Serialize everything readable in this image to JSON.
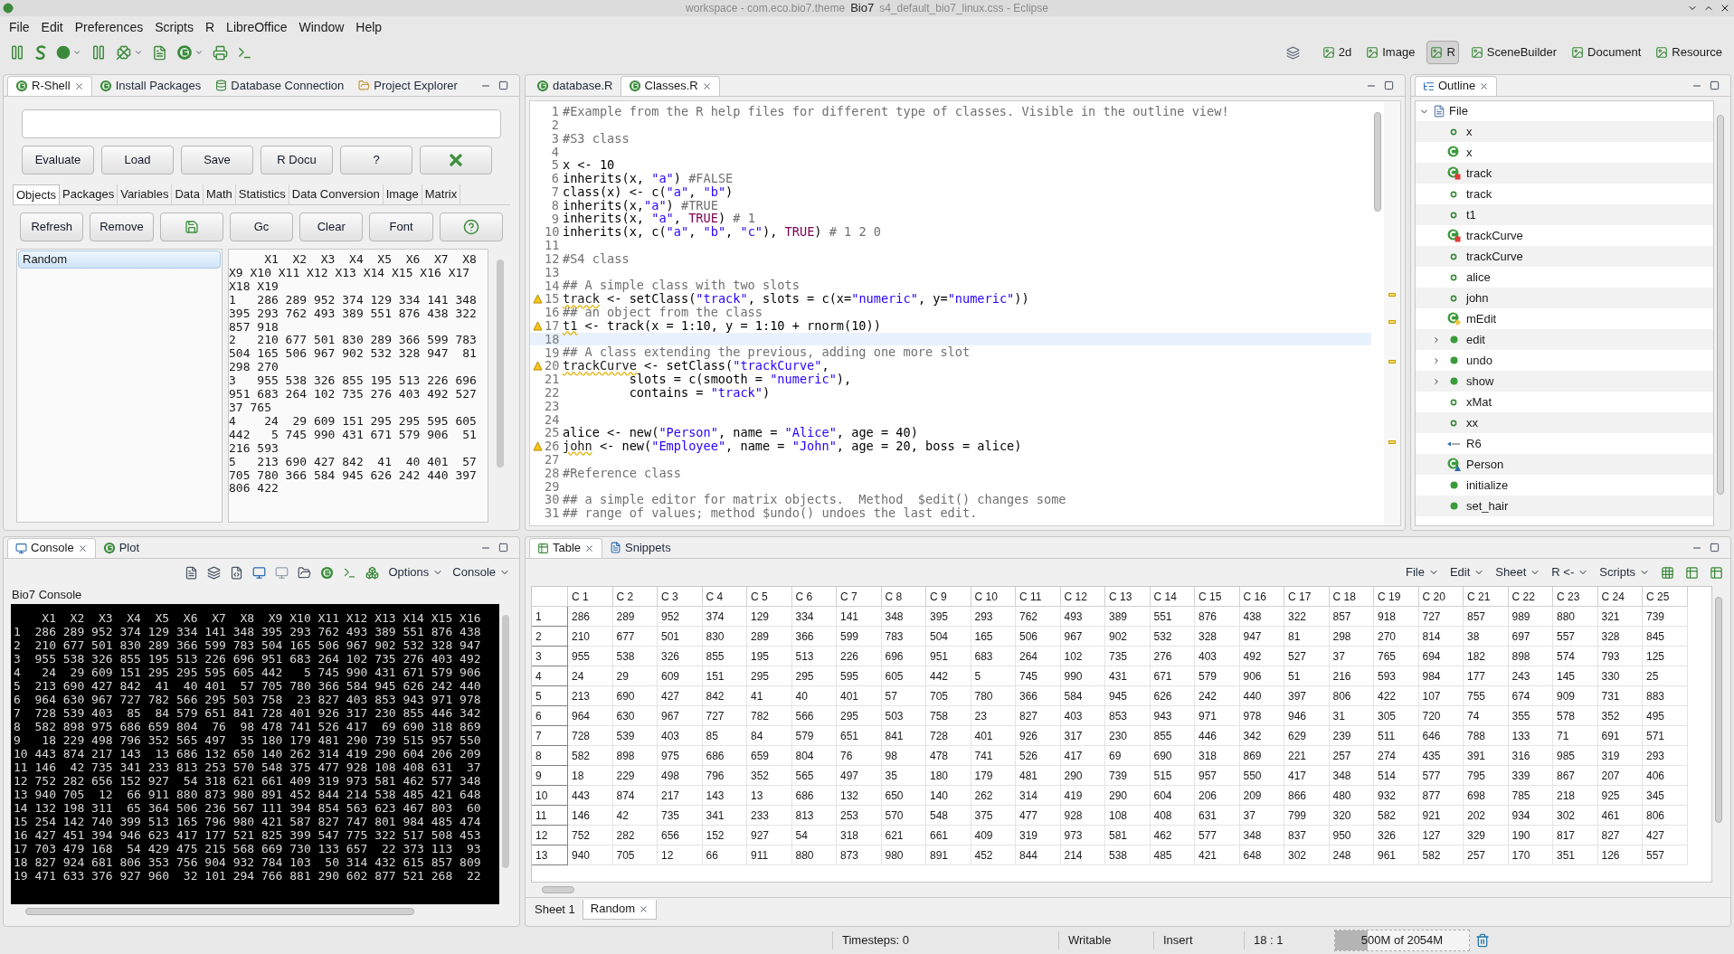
{
  "window": {
    "title": "Bio7",
    "caption": "workspace - com.eco.bio7.theme",
    "caption_end": "s4_default_bio7_linux.css - Eclipse"
  },
  "menu": [
    "File",
    "Edit",
    "Preferences",
    "Scripts",
    "R",
    "LibreOffice",
    "Window",
    "Help"
  ],
  "perspectives": [
    {
      "label": "2d",
      "selected": false
    },
    {
      "label": "Image",
      "selected": false
    },
    {
      "label": "R",
      "selected": true
    },
    {
      "label": "SceneBuilder",
      "selected": false
    },
    {
      "label": "Document",
      "selected": false
    },
    {
      "label": "Resource",
      "selected": false
    }
  ],
  "rshell": {
    "tabs": [
      {
        "label": "R-Shell",
        "selected": true,
        "closable": true
      },
      {
        "label": "Install Packages",
        "selected": false,
        "closable": false
      },
      {
        "label": "Database Connection",
        "selected": false,
        "closable": false
      },
      {
        "label": "Project Explorer",
        "selected": false,
        "closable": false
      }
    ],
    "buttons": [
      {
        "kind": "text",
        "label": "Evaluate"
      },
      {
        "kind": "text",
        "label": "Load"
      },
      {
        "kind": "text",
        "label": "Save"
      },
      {
        "kind": "text",
        "label": "R Docu"
      },
      {
        "kind": "text",
        "label": "?"
      },
      {
        "kind": "close"
      }
    ],
    "subtabs": [
      {
        "label": "Objects",
        "selected": true
      },
      {
        "label": "Packages",
        "selected": false
      },
      {
        "label": "Variables",
        "selected": false
      },
      {
        "label": "Data",
        "selected": false
      },
      {
        "label": "Math",
        "selected": false
      },
      {
        "label": "Statistics",
        "selected": false
      },
      {
        "label": "Data Conversion",
        "selected": false
      },
      {
        "label": "Image",
        "selected": false
      },
      {
        "label": "Matrix",
        "selected": false
      }
    ],
    "object_buttons": [
      {
        "kind": "text",
        "label": "Refresh"
      },
      {
        "kind": "text",
        "label": "Remove"
      },
      {
        "kind": "save"
      },
      {
        "kind": "text",
        "label": "Gc"
      },
      {
        "kind": "text",
        "label": "Clear"
      },
      {
        "kind": "text",
        "label": "Font"
      },
      {
        "kind": "help"
      }
    ],
    "objects": [
      {
        "label": "Random",
        "selected": true
      }
    ],
    "output": [
      "     X1  X2  X3  X4  X5  X6  X7  X8",
      "X9 X10 X11 X12 X13 X14 X15 X16 X17",
      "X18 X19",
      "1   286 289 952 374 129 334 141 348",
      "395 293 762 493 389 551 876 438 322",
      "857 918",
      "2   210 677 501 830 289 366 599 783",
      "504 165 506 967 902 532 328 947  81",
      "298 270",
      "3   955 538 326 855 195 513 226 696",
      "951 683 264 102 735 276 403 492 527",
      "37 765",
      "4    24  29 609 151 295 295 595 605",
      "442   5 745 990 431 671 579 906  51",
      "216 593",
      "5   213 690 427 842  41  40 401  57",
      "705 780 366 584 945 626 242 440 397",
      "806 422"
    ]
  },
  "editor": {
    "numbers": [
      "1",
      "2",
      "3",
      "4",
      "5",
      "6",
      "7",
      "8",
      "9",
      "10",
      "11",
      "12",
      "13",
      "14",
      "15",
      "16",
      "17",
      "18",
      "19",
      "20",
      "21",
      "22",
      "23",
      "24",
      "25",
      "26",
      "27",
      "28",
      "29",
      "30",
      "31"
    ],
    "tabs": [
      {
        "label": "database.R",
        "selected": false,
        "closable": false
      },
      {
        "label": "Classes.R",
        "selected": true,
        "closable": true
      }
    ],
    "lines": [
      {
        "text": "#Example from the R help files for different type of classes. Visible in the outline view!",
        "warning": false,
        "current": false
      },
      {
        "warning": false,
        "current": false
      },
      {
        "text": "#S3 class",
        "warning": false,
        "current": false
      },
      {
        "warning": false,
        "current": false
      },
      {
        "text": "x <- 10",
        "warning": false,
        "current": false
      },
      {
        "text": "inherits(x, \"a\") #FALSE",
        "warning": false,
        "current": false
      },
      {
        "text": "class(x) <- c(\"a\", \"b\")",
        "warning": false,
        "current": false
      },
      {
        "text": "inherits(x,\"a\") #TRUE",
        "warning": false,
        "current": false
      },
      {
        "text": "inherits(x, \"a\", TRUE) # 1",
        "warning": false,
        "current": false
      },
      {
        "text": "inherits(x, c(\"a\", \"b\", \"c\"), TRUE) # 1 2 0",
        "warning": false,
        "current": false
      },
      {
        "warning": false,
        "current": false
      },
      {
        "text": "#S4 class",
        "warning": false,
        "current": false
      },
      {
        "warning": false,
        "current": false
      },
      {
        "text": "## A simple class with two slots",
        "warning": false,
        "current": false
      },
      {
        "text": "track <- setClass(\"track\", slots = c(x=\"numeric\", y=\"numeric\"))",
        "warning": true,
        "current": false
      },
      {
        "text": "## an object from the class",
        "warning": false,
        "current": false
      },
      {
        "text": "t1 <- track(x = 1:10, y = 1:10 + rnorm(10))",
        "warning": true,
        "current": false
      },
      {
        "warning": false,
        "current": true
      },
      {
        "text": "## A class extending the previous, adding one more slot",
        "warning": false,
        "current": false
      },
      {
        "text": "trackCurve <- setClass(\"trackCurve\",",
        "warning": true,
        "current": false
      },
      {
        "text": "         slots = c(smooth = \"numeric\"),",
        "warning": false,
        "current": false
      },
      {
        "text": "         contains = \"track\")",
        "warning": false,
        "current": false
      },
      {
        "warning": false,
        "current": false
      },
      {
        "warning": false,
        "current": false
      },
      {
        "text": "alice <- new(\"Person\", name = \"Alice\", age = 40)",
        "warning": false,
        "current": false
      },
      {
        "text": "john <- new(\"Employee\", name = \"John\", age = 20, boss = alice)",
        "warning": true,
        "current": false
      },
      {
        "warning": false,
        "current": false
      },
      {
        "text": "#Reference class",
        "warning": false,
        "current": false
      },
      {
        "warning": false,
        "current": false
      },
      {
        "text": "## a simple editor for matrix objects.  Method  $edit() changes some",
        "warning": false,
        "current": false
      },
      {
        "text": "## range of values; method $undo() undoes the last edit.",
        "warning": false,
        "current": false
      }
    ]
  },
  "outline": {
    "tab": "Outline",
    "root": {
      "label": "File",
      "expanded": true,
      "children": [
        {
          "label": "x",
          "kind": "variable"
        },
        {
          "label": "x",
          "kind": "s3"
        },
        {
          "label": "track",
          "kind": "s4"
        },
        {
          "label": "track",
          "kind": "variable"
        },
        {
          "label": "t1",
          "kind": "variable"
        },
        {
          "label": "trackCurve",
          "kind": "s4"
        },
        {
          "label": "trackCurve",
          "kind": "variable"
        },
        {
          "label": "alice",
          "kind": "variable"
        },
        {
          "label": "john",
          "kind": "variable"
        },
        {
          "label": "mEdit",
          "kind": "reference"
        },
        {
          "label": "edit",
          "kind": "method",
          "expanded": false
        },
        {
          "label": "undo",
          "kind": "method",
          "expanded": false
        },
        {
          "label": "show",
          "kind": "method",
          "expanded": false
        },
        {
          "label": "xMat",
          "kind": "variable"
        },
        {
          "label": "xx",
          "kind": "variable"
        },
        {
          "label": "R6",
          "kind": "r6"
        },
        {
          "label": "Person",
          "kind": "r6class"
        },
        {
          "label": "initialize",
          "kind": "method"
        },
        {
          "label": "set_hair",
          "kind": "method"
        }
      ]
    }
  },
  "console": {
    "tabs": [
      {
        "label": "Console",
        "selected": true,
        "closable": true
      },
      {
        "label": "Plot",
        "selected": false,
        "closable": false
      }
    ],
    "menus": [
      "Options",
      "Console"
    ],
    "title": "Bio7 Console",
    "columns": [
      "X1",
      "X2",
      "X3",
      "X4",
      "X5",
      "X6",
      "X7",
      "X8",
      "X9",
      "X10",
      "X11",
      "X12",
      "X13",
      "X14",
      "X15",
      "X16"
    ],
    "rows": [
      {
        "name": "1",
        "values": [
          "286",
          "289",
          "952",
          "374",
          "129",
          "334",
          "141",
          "348",
          "395",
          "293",
          "762",
          "493",
          "389",
          "551",
          "876",
          "438"
        ]
      },
      {
        "name": "2",
        "values": [
          "210",
          "677",
          "501",
          "830",
          "289",
          "366",
          "599",
          "783",
          "504",
          "165",
          "506",
          "967",
          "902",
          "532",
          "328",
          "947"
        ]
      },
      {
        "name": "3",
        "values": [
          "955",
          "538",
          "326",
          "855",
          "195",
          "513",
          "226",
          "696",
          "951",
          "683",
          "264",
          "102",
          "735",
          "276",
          "403",
          "492"
        ]
      },
      {
        "name": "4",
        "values": [
          "24",
          "29",
          "609",
          "151",
          "295",
          "295",
          "595",
          "605",
          "442",
          "5",
          "745",
          "990",
          "431",
          "671",
          "579",
          "906"
        ]
      },
      {
        "name": "5",
        "values": [
          "213",
          "690",
          "427",
          "842",
          "41",
          "40",
          "401",
          "57",
          "705",
          "780",
          "366",
          "584",
          "945",
          "626",
          "242",
          "440"
        ]
      },
      {
        "name": "6",
        "values": [
          "964",
          "630",
          "967",
          "727",
          "782",
          "566",
          "295",
          "503",
          "758",
          "23",
          "827",
          "403",
          "853",
          "943",
          "971",
          "978"
        ]
      },
      {
        "name": "7",
        "values": [
          "728",
          "539",
          "403",
          "85",
          "84",
          "579",
          "651",
          "841",
          "728",
          "401",
          "926",
          "317",
          "230",
          "855",
          "446",
          "342"
        ]
      },
      {
        "name": "8",
        "values": [
          "582",
          "898",
          "975",
          "686",
          "659",
          "804",
          "76",
          "98",
          "478",
          "741",
          "526",
          "417",
          "69",
          "690",
          "318",
          "869"
        ]
      },
      {
        "name": "9",
        "values": [
          "18",
          "229",
          "498",
          "796",
          "352",
          "565",
          "497",
          "35",
          "180",
          "179",
          "481",
          "290",
          "739",
          "515",
          "957",
          "550"
        ]
      },
      {
        "name": "10",
        "values": [
          "443",
          "874",
          "217",
          "143",
          "13",
          "686",
          "132",
          "650",
          "140",
          "262",
          "314",
          "419",
          "290",
          "604",
          "206",
          "209"
        ]
      },
      {
        "name": "11",
        "values": [
          "146",
          "42",
          "735",
          "341",
          "233",
          "813",
          "253",
          "570",
          "548",
          "375",
          "477",
          "928",
          "108",
          "408",
          "631",
          "37"
        ]
      },
      {
        "name": "12",
        "values": [
          "752",
          "282",
          "656",
          "152",
          "927",
          "54",
          "318",
          "621",
          "661",
          "409",
          "319",
          "973",
          "581",
          "462",
          "577",
          "348"
        ]
      },
      {
        "name": "13",
        "values": [
          "940",
          "705",
          "12",
          "66",
          "911",
          "880",
          "873",
          "980",
          "891",
          "452",
          "844",
          "214",
          "538",
          "485",
          "421",
          "648"
        ]
      },
      {
        "name": "14",
        "values": [
          "132",
          "198",
          "311",
          "65",
          "364",
          "506",
          "236",
          "567",
          "111",
          "394",
          "854",
          "563",
          "623",
          "467",
          "803",
          "60"
        ]
      },
      {
        "name": "15",
        "values": [
          "254",
          "142",
          "740",
          "399",
          "513",
          "165",
          "796",
          "980",
          "421",
          "587",
          "827",
          "747",
          "801",
          "984",
          "485",
          "474"
        ]
      },
      {
        "name": "16",
        "values": [
          "427",
          "451",
          "394",
          "946",
          "623",
          "417",
          "177",
          "521",
          "825",
          "399",
          "547",
          "775",
          "322",
          "517",
          "508",
          "453"
        ]
      },
      {
        "name": "17",
        "values": [
          "703",
          "479",
          "168",
          "54",
          "429",
          "475",
          "215",
          "568",
          "669",
          "730",
          "133",
          "657",
          "22",
          "373",
          "113",
          "93"
        ]
      },
      {
        "name": "18",
        "values": [
          "827",
          "924",
          "681",
          "806",
          "353",
          "756",
          "904",
          "932",
          "784",
          "103",
          "50",
          "314",
          "432",
          "615",
          "857",
          "809"
        ]
      },
      {
        "name": "19",
        "values": [
          "471",
          "633",
          "376",
          "927",
          "960",
          "32",
          "101",
          "294",
          "766",
          "881",
          "290",
          "602",
          "877",
          "521",
          "268",
          "22"
        ]
      }
    ]
  },
  "table": {
    "tabs": [
      {
        "label": "Table",
        "selected": true,
        "closable": true
      },
      {
        "label": "Snippets",
        "selected": false,
        "closable": false
      }
    ],
    "menus": [
      "File",
      "Edit",
      "Sheet",
      "R <-",
      "Scripts"
    ],
    "columns": [
      "C 1",
      "C 2",
      "C 3",
      "C 4",
      "C 5",
      "C 6",
      "C 7",
      "C 8",
      "C 9",
      "C 10",
      "C 11",
      "C 12",
      "C 13",
      "C 14",
      "C 15",
      "C 16",
      "C 17",
      "C 18",
      "C 19",
      "C 20",
      "C 21",
      "C 22",
      "C 23",
      "C 24",
      "C 25"
    ],
    "rows": [
      {
        "name": "1",
        "cells": [
          "286",
          "289",
          "952",
          "374",
          "129",
          "334",
          "141",
          "348",
          "395",
          "293",
          "762",
          "493",
          "389",
          "551",
          "876",
          "438",
          "322",
          "857",
          "918",
          "727",
          "857",
          "989",
          "880",
          "321",
          "739"
        ]
      },
      {
        "name": "2",
        "cells": [
          "210",
          "677",
          "501",
          "830",
          "289",
          "366",
          "599",
          "783",
          "504",
          "165",
          "506",
          "967",
          "902",
          "532",
          "328",
          "947",
          "81",
          "298",
          "270",
          "814",
          "38",
          "697",
          "557",
          "328",
          "845"
        ]
      },
      {
        "name": "3",
        "cells": [
          "955",
          "538",
          "326",
          "855",
          "195",
          "513",
          "226",
          "696",
          "951",
          "683",
          "264",
          "102",
          "735",
          "276",
          "403",
          "492",
          "527",
          "37",
          "765",
          "694",
          "182",
          "898",
          "574",
          "793",
          "125"
        ]
      },
      {
        "name": "4",
        "cells": [
          "24",
          "29",
          "609",
          "151",
          "295",
          "295",
          "595",
          "605",
          "442",
          "5",
          "745",
          "990",
          "431",
          "671",
          "579",
          "906",
          "51",
          "216",
          "593",
          "984",
          "177",
          "243",
          "145",
          "330",
          "25"
        ]
      },
      {
        "name": "5",
        "cells": [
          "213",
          "690",
          "427",
          "842",
          "41",
          "40",
          "401",
          "57",
          "705",
          "780",
          "366",
          "584",
          "945",
          "626",
          "242",
          "440",
          "397",
          "806",
          "422",
          "107",
          "755",
          "674",
          "909",
          "731",
          "883"
        ]
      },
      {
        "name": "6",
        "cells": [
          "964",
          "630",
          "967",
          "727",
          "782",
          "566",
          "295",
          "503",
          "758",
          "23",
          "827",
          "403",
          "853",
          "943",
          "971",
          "978",
          "946",
          "31",
          "305",
          "720",
          "74",
          "355",
          "578",
          "352",
          "495"
        ]
      },
      {
        "name": "7",
        "cells": [
          "728",
          "539",
          "403",
          "85",
          "84",
          "579",
          "651",
          "841",
          "728",
          "401",
          "926",
          "317",
          "230",
          "855",
          "446",
          "342",
          "629",
          "239",
          "511",
          "646",
          "788",
          "133",
          "71",
          "691",
          "571"
        ]
      },
      {
        "name": "8",
        "cells": [
          "582",
          "898",
          "975",
          "686",
          "659",
          "804",
          "76",
          "98",
          "478",
          "741",
          "526",
          "417",
          "69",
          "690",
          "318",
          "869",
          "221",
          "257",
          "274",
          "435",
          "391",
          "316",
          "985",
          "319",
          "293"
        ]
      },
      {
        "name": "9",
        "cells": [
          "18",
          "229",
          "498",
          "796",
          "352",
          "565",
          "497",
          "35",
          "180",
          "179",
          "481",
          "290",
          "739",
          "515",
          "957",
          "550",
          "417",
          "348",
          "514",
          "577",
          "795",
          "339",
          "867",
          "207",
          "406"
        ]
      },
      {
        "name": "10",
        "cells": [
          "443",
          "874",
          "217",
          "143",
          "13",
          "686",
          "132",
          "650",
          "140",
          "262",
          "314",
          "419",
          "290",
          "604",
          "206",
          "209",
          "866",
          "480",
          "932",
          "877",
          "698",
          "785",
          "218",
          "925",
          "345"
        ]
      },
      {
        "name": "11",
        "cells": [
          "146",
          "42",
          "735",
          "341",
          "233",
          "813",
          "253",
          "570",
          "548",
          "375",
          "477",
          "928",
          "108",
          "408",
          "631",
          "37",
          "799",
          "320",
          "582",
          "921",
          "202",
          "934",
          "302",
          "461",
          "806"
        ]
      },
      {
        "name": "12",
        "cells": [
          "752",
          "282",
          "656",
          "152",
          "927",
          "54",
          "318",
          "621",
          "661",
          "409",
          "319",
          "973",
          "581",
          "462",
          "577",
          "348",
          "837",
          "950",
          "326",
          "127",
          "329",
          "190",
          "817",
          "827",
          "427"
        ]
      },
      {
        "name": "13",
        "cells": [
          "940",
          "705",
          "12",
          "66",
          "911",
          "880",
          "873",
          "980",
          "891",
          "452",
          "844",
          "214",
          "538",
          "485",
          "421",
          "648",
          "302",
          "248",
          "961",
          "582",
          "257",
          "170",
          "351",
          "126",
          "557"
        ]
      }
    ],
    "sheets": [
      {
        "label": "Sheet 1",
        "selected": false,
        "closable": false
      },
      {
        "label": "Random",
        "selected": true,
        "closable": true
      }
    ]
  },
  "status_bar": {
    "timesteps": "Timesteps: 0",
    "mode": "Writable",
    "insert": "Insert",
    "position": "18 : 1",
    "memory": {
      "text": "500M of 2054M",
      "level": 0.24
    }
  }
}
